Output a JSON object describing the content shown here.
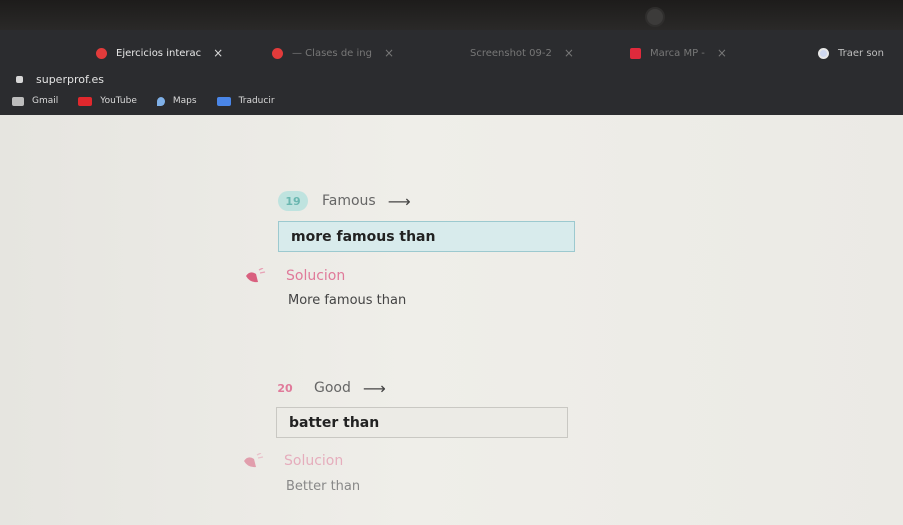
{
  "browser": {
    "tabs": [
      {
        "label": "Ejercicios interac",
        "favicon_color": "#e23b3b",
        "active": true
      },
      {
        "label": "— Clases de ing",
        "favicon_color": "#e23b3b",
        "active": false
      },
      {
        "label": "Screenshot 09-2",
        "favicon_color": "#2b2c2f",
        "active": false
      },
      {
        "label": "Marca MP -",
        "favicon_color": "#e02a3c",
        "active": false
      },
      {
        "label": "Traer son",
        "favicon_color": "#cfd8f0",
        "active": false
      }
    ],
    "close_glyph": "×",
    "url": "superprof.es",
    "bookmarks": [
      {
        "label": "Gmail",
        "icon": "gmail-icon",
        "color": "#bdbdbd"
      },
      {
        "label": "YouTube",
        "icon": "youtube-icon",
        "color": "#e0282d"
      },
      {
        "label": "Maps",
        "icon": "maps-icon",
        "color": "#7fb0e8"
      },
      {
        "label": "Traducir",
        "icon": "translate-icon",
        "color": "#4a86e8"
      }
    ]
  },
  "exercises": [
    {
      "number": "19",
      "word": "Famous",
      "arrow": "⟶",
      "answer": "more famous than",
      "solution_label": "Solucion",
      "solution": "More famous than",
      "number_color": "#6ab7b0",
      "number_bg": "#bfe3df",
      "answer_bg": "#d8ebec",
      "answer_border": "#9cc9cf"
    },
    {
      "number": "20",
      "word": "Good",
      "arrow": "⟶",
      "answer": "batter than",
      "solution_label": "Solucion",
      "solution": "Better than",
      "number_color": "#e07a9a",
      "number_bg": "transparent",
      "answer_bg": "#ecebe6",
      "answer_border": "#c9c8c3"
    }
  ]
}
